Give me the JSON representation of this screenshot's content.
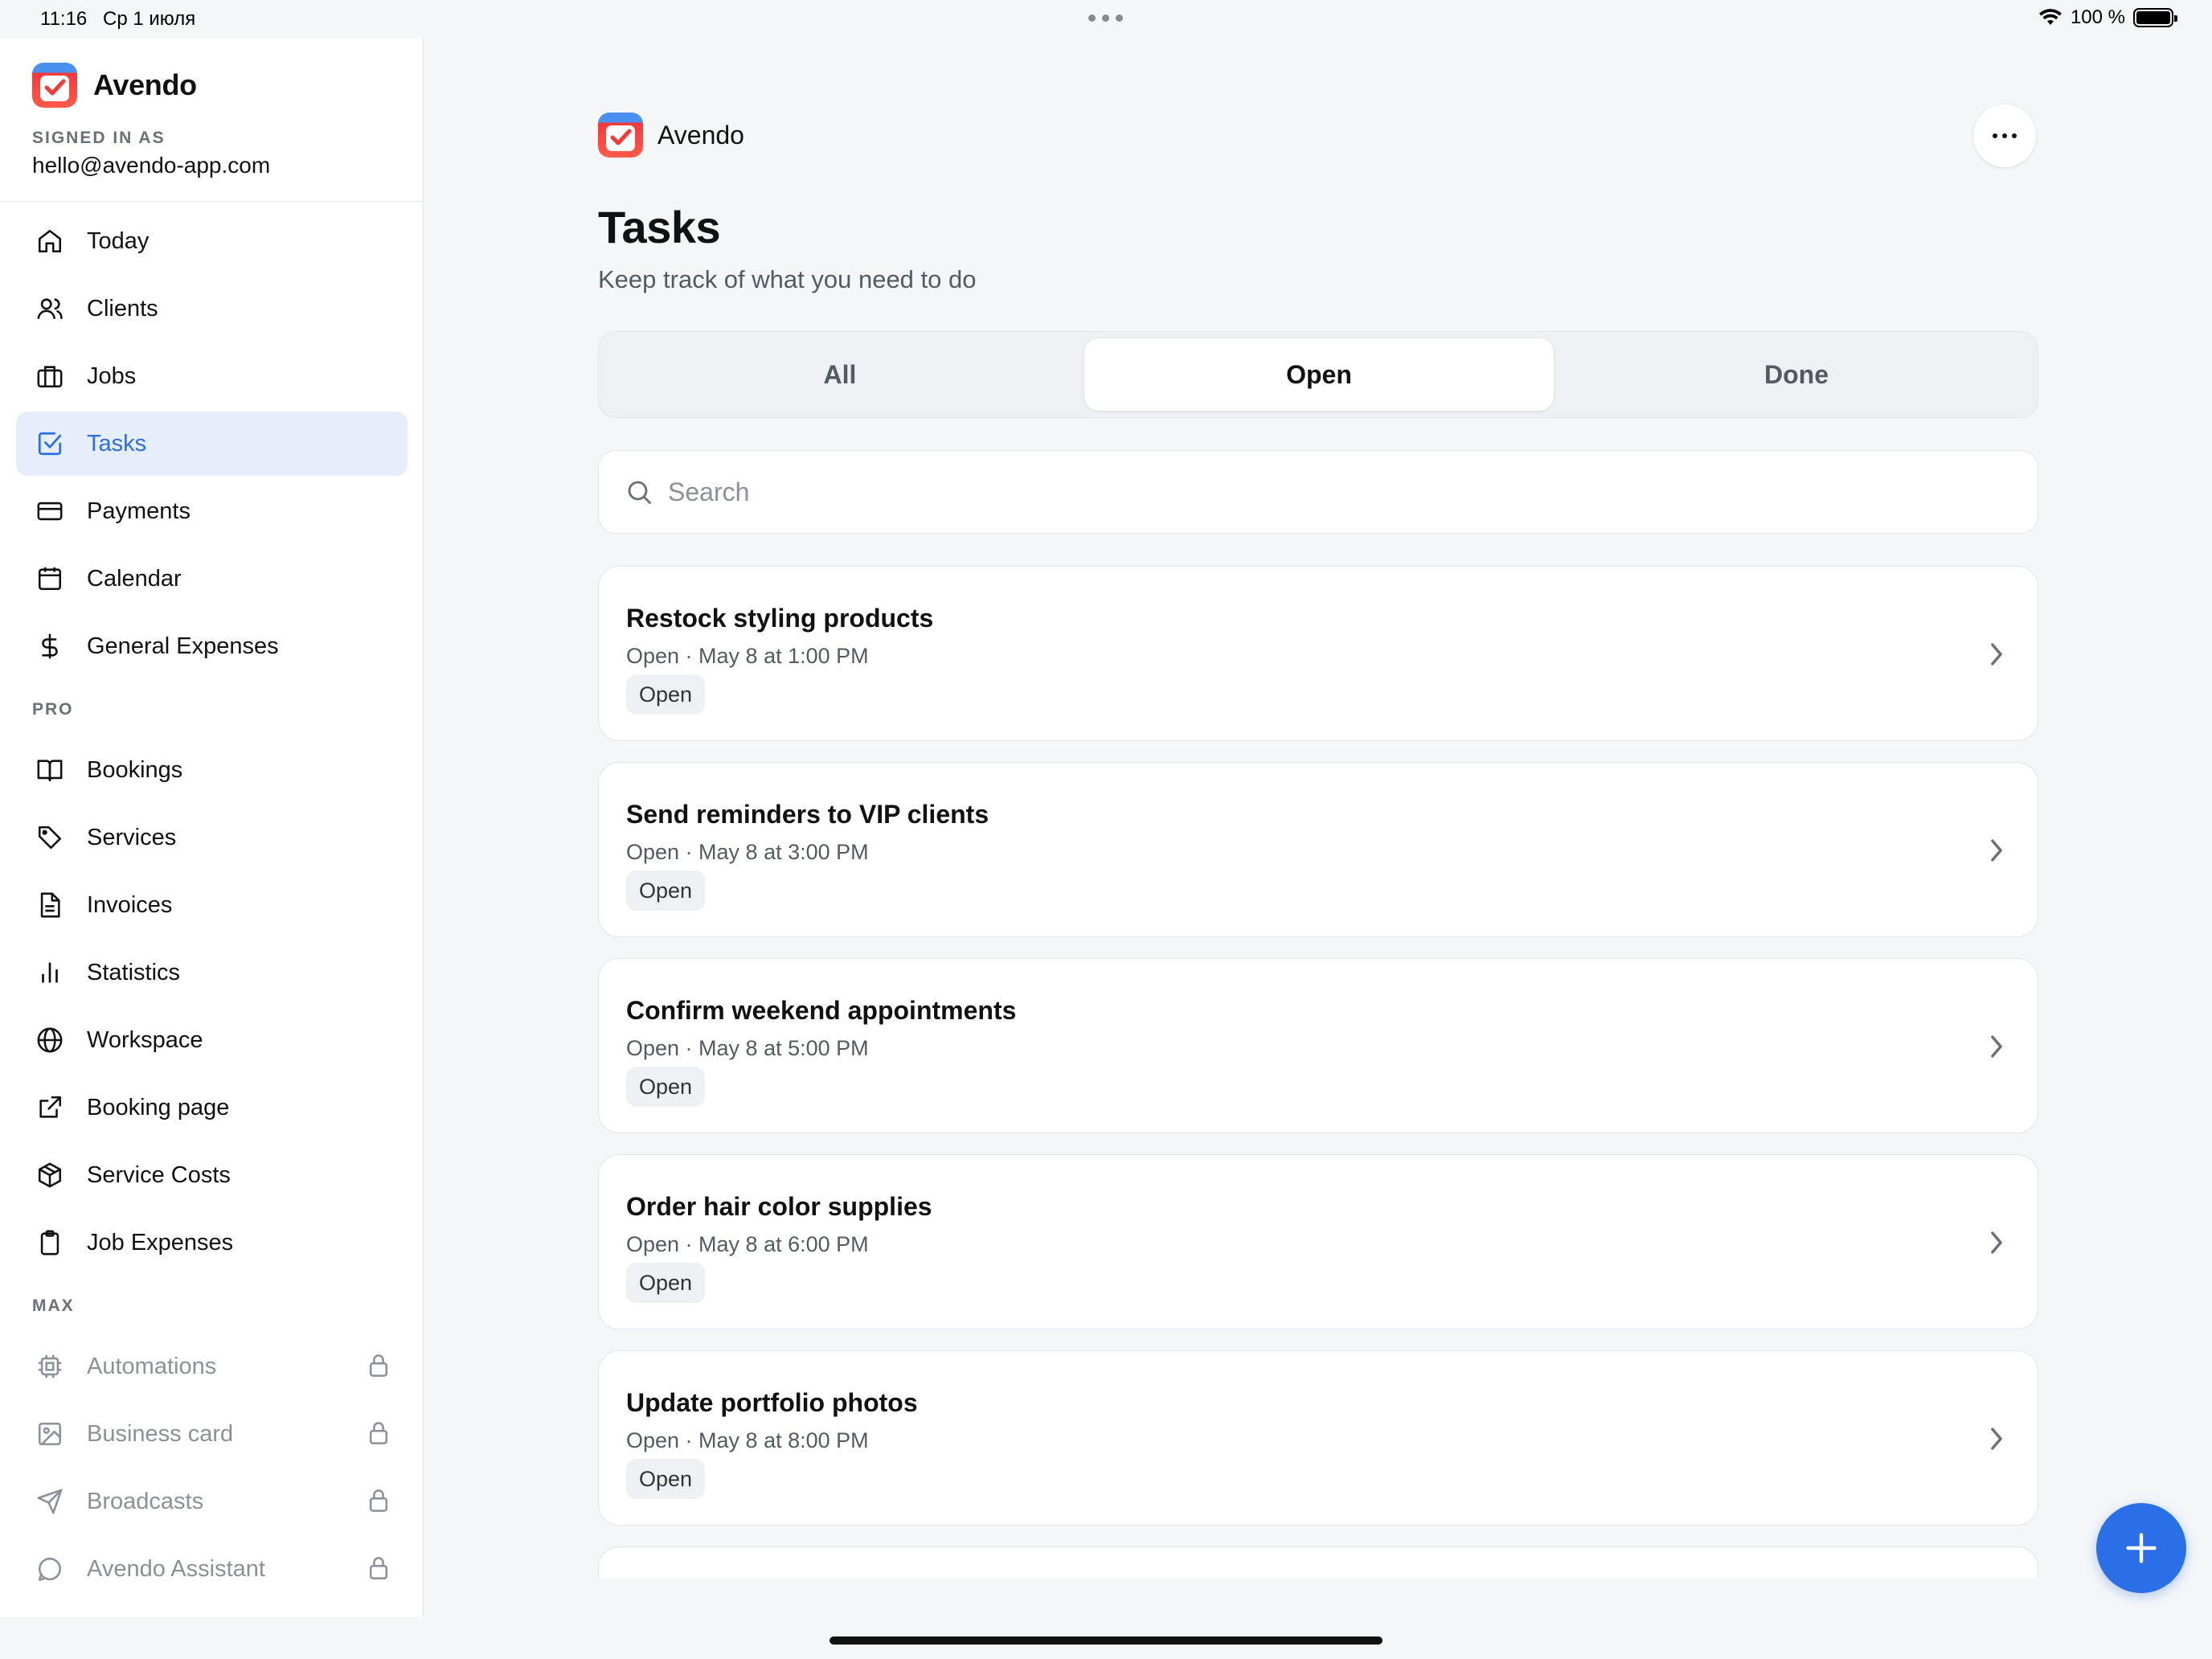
{
  "status_bar": {
    "time": "11:16",
    "date": "Ср 1 июля",
    "battery": "100 %"
  },
  "sidebar": {
    "brand": "Avendo",
    "signed_in_label": "SIGNED IN AS",
    "email": "hello@avendo-app.com",
    "items": [
      {
        "label": "Today",
        "icon": "house-icon"
      },
      {
        "label": "Clients",
        "icon": "users-icon"
      },
      {
        "label": "Jobs",
        "icon": "briefcase-icon"
      },
      {
        "label": "Tasks",
        "icon": "checkbox-icon",
        "active": true
      },
      {
        "label": "Payments",
        "icon": "credit-card-icon"
      },
      {
        "label": "Calendar",
        "icon": "calendar-icon"
      },
      {
        "label": "General Expenses",
        "icon": "dollar-icon"
      }
    ],
    "pro_label": "PRO",
    "pro_items": [
      {
        "label": "Bookings",
        "icon": "book-icon"
      },
      {
        "label": "Services",
        "icon": "tag-icon"
      },
      {
        "label": "Invoices",
        "icon": "document-icon"
      },
      {
        "label": "Statistics",
        "icon": "bar-chart-icon"
      },
      {
        "label": "Workspace",
        "icon": "globe-icon"
      },
      {
        "label": "Booking page",
        "icon": "external-link-icon"
      },
      {
        "label": "Service Costs",
        "icon": "package-icon"
      },
      {
        "label": "Job Expenses",
        "icon": "clipboard-icon"
      }
    ],
    "max_label": "MAX",
    "max_items": [
      {
        "label": "Automations",
        "icon": "chip-icon",
        "locked": true
      },
      {
        "label": "Business card",
        "icon": "image-icon",
        "locked": true
      },
      {
        "label": "Broadcasts",
        "icon": "send-icon",
        "locked": true
      },
      {
        "label": "Avendo Assistant",
        "icon": "chat-icon",
        "locked": true
      }
    ]
  },
  "main": {
    "brand": "Avendo",
    "title": "Tasks",
    "subtitle": "Keep track of what you need to do",
    "tabs": [
      {
        "label": "All"
      },
      {
        "label": "Open",
        "active": true
      },
      {
        "label": "Done"
      }
    ],
    "search_placeholder": "Search",
    "tasks": [
      {
        "title": "Restock styling products",
        "meta": "Open · May 8 at 1:00 PM",
        "badge": "Open"
      },
      {
        "title": "Send reminders to VIP clients",
        "meta": "Open · May 8 at 3:00 PM",
        "badge": "Open"
      },
      {
        "title": "Confirm weekend appointments",
        "meta": "Open · May 8 at 5:00 PM",
        "badge": "Open"
      },
      {
        "title": "Order hair color supplies",
        "meta": "Open · May 8 at 6:00 PM",
        "badge": "Open"
      },
      {
        "title": "Update portfolio photos",
        "meta": "Open · May 8 at 8:00 PM",
        "badge": "Open"
      }
    ]
  },
  "colors": {
    "accent": "#2b6fe8",
    "active_bg": "#e6eefc",
    "muted": "#8c9098"
  }
}
